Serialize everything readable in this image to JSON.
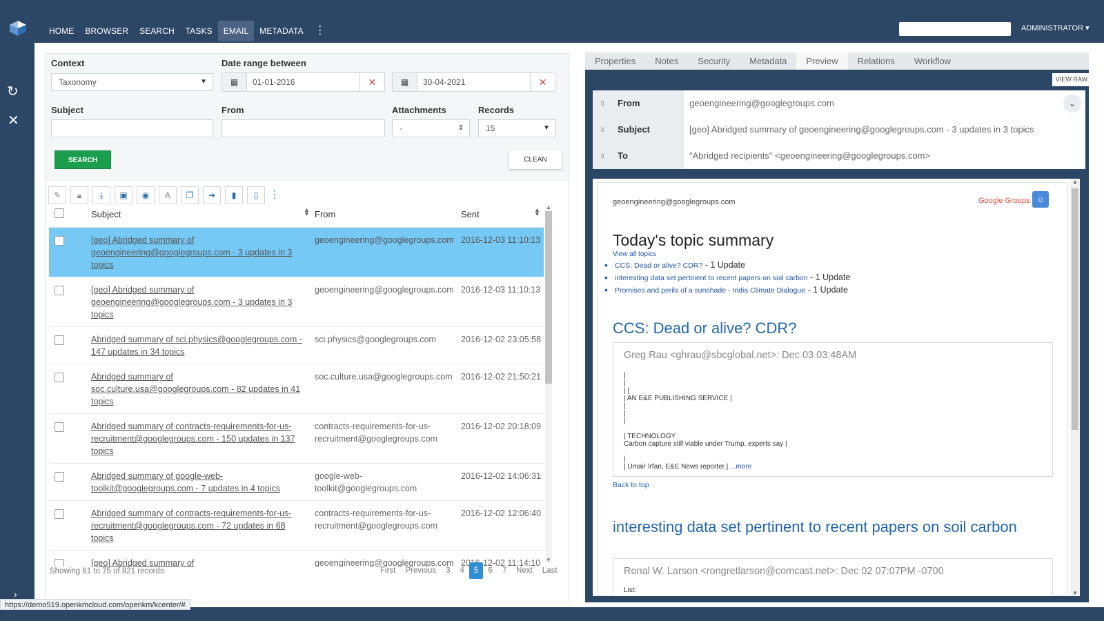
{
  "nav": {
    "items": [
      "HOME",
      "BROWSER",
      "SEARCH",
      "TASKS",
      "EMAIL",
      "METADATA"
    ],
    "active": "EMAIL",
    "more_icon": "vertical-dots-icon",
    "admin": "ADMINISTRATOR ▾"
  },
  "status_url": "https://demo519.openkmcloud.com/openkm/kcenter/#",
  "filters": {
    "context_label": "Context",
    "context_value": "Taxonomy",
    "date_label": "Date range between",
    "date_from": "01-01-2016",
    "date_to": "30-04-2021",
    "subject_label": "Subject",
    "from_label": "From",
    "attachments_label": "Attachments",
    "attachments_value": "-",
    "records_label": "Records",
    "records_value": "15",
    "search_btn": "SEARCH",
    "clean_btn": "CLEAN"
  },
  "grid": {
    "headers": {
      "subject": "Subject",
      "from": "From",
      "sent": "Sent"
    },
    "rows": [
      {
        "subject": "[geo] Abridged summary of geoengineering@googlegroups.com - 3 updates in 3 topics",
        "from": "geoengineering@googlegroups.com",
        "sent": "2016-12-03 11:10:13"
      },
      {
        "subject": "[geo] Abridged summary of geoengineering@googlegroups.com - 3 updates in 3 topics",
        "from": "geoengineering@googlegroups.com",
        "sent": "2016-12-03 11:10:13"
      },
      {
        "subject": "Abridged summary of sci.physics@googlegroups.com - 147 updates in 34 topics",
        "from": "sci.physics@googlegroups.com",
        "sent": "2016-12-02 23:05:58"
      },
      {
        "subject": "Abridged summary of soc.culture.usa@googlegroups.com - 82 updates in 41 topics",
        "from": "soc.culture.usa@googlegroups.com",
        "sent": "2016-12-02 21:50:21"
      },
      {
        "subject": "Abridged summary of contracts-requirements-for-us-recruitment@googlegroups.com - 150 updates in 137 topics",
        "from": "contracts-requirements-for-us-recruitment@googlegroups.com",
        "sent": "2016-12-02 20:18:09"
      },
      {
        "subject": "Abridged summary of google-web-toolkit@googlegroups.com - 7 updates in 4 topics",
        "from": "google-web-toolkit@googlegroups.com",
        "sent": "2016-12-02 14:06:31"
      },
      {
        "subject": "Abridged summary of contracts-requirements-for-us-recruitment@googlegroups.com - 72 updates in 68 topics",
        "from": "contracts-requirements-for-us-recruitment@googlegroups.com",
        "sent": "2016-12-02 12:06:40"
      },
      {
        "subject": "[geo] Abridged summary of",
        "from": "geoengineering@googlegroups.com",
        "sent": "2016-12-02 11:14:10"
      }
    ],
    "showing": "Showing 61 to 75 of 821 records"
  },
  "pager": {
    "first": "First",
    "previous": "Previous",
    "pages": [
      "3",
      "4",
      "5",
      "6",
      "7"
    ],
    "current": "5",
    "next": "Next",
    "last": "Last"
  },
  "tabs": [
    "Properties",
    "Notes",
    "Security",
    "Metadata",
    "Preview",
    "Relations",
    "Workflow"
  ],
  "active_tab": "Preview",
  "preview": {
    "view_raw": "VIEW RAW",
    "from_label": "From",
    "from_value": "geoengineering@googlegroups.com",
    "subject_label": "Subject",
    "subject_value": "[geo] Abridged summary of geoengineering@googlegroups.com - 3 updates in 3 topics",
    "to_label": "To",
    "to_value": "\"Abridged recipients\" <geoengineering@googlegroups.com>",
    "mail": {
      "sender": "geoengineering@googlegroups.com",
      "brand": "Google Groups",
      "title": "Today's topic summary",
      "view_all": "View all topics",
      "topics": [
        {
          "link": "CCS: Dead or alive? CDR?",
          "count": " - 1 Update"
        },
        {
          "link": "interesting data set pertinent to recent papers on soil carbon",
          "count": " - 1 Update"
        },
        {
          "link": "Promises and perils of a sunshade - India Climate Dialogue",
          "count": " - 1 Update"
        }
      ],
      "h2_1": "CCS: Dead or alive? CDR?",
      "q1_head": "Greg Rau <ghrau@sbcglobal.net>: Dec 03 03:48AM",
      "q1_l1": "|",
      "q1_l2": "|",
      "q1_l3": "| |",
      "q1_l4": "| AN E&E PUBLISHING SERVICE |",
      "q1_l5": "|",
      "q1_l6": "|",
      "q1_l7": "|",
      "q1_l8": "| TECHNOLOGY",
      "q1_l9": "Carbon capture still viable under Trump, experts say |",
      "q1_l10": "|",
      "q1_l11": "| Umair Irfan, E&E News reporter | ",
      "q1_more": "...more",
      "back_top": "Back to top",
      "h2_2": "interesting data set pertinent to recent papers on soil carbon",
      "q2_head": "Ronal W. Larson <rongretlarson@comcast.net>: Dec 02 07:07PM -0700",
      "q2_l1": "List:"
    }
  },
  "colors": {
    "nav_bg": "#2c4666",
    "selected_row": "#76c8f5",
    "search_btn": "#1b9e4e",
    "link": "#2255aa"
  }
}
